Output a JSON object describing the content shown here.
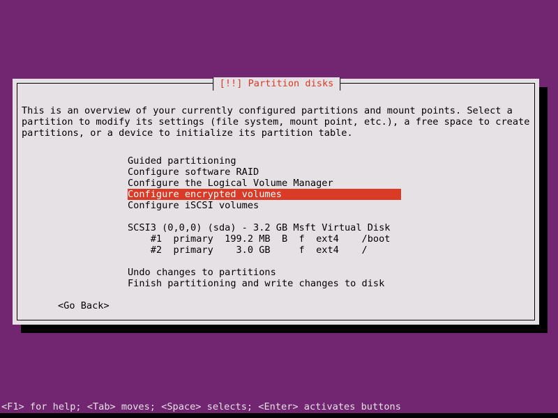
{
  "screen": {
    "background_color": "#722672",
    "foreground_color": "#e6e1e5"
  },
  "dialog": {
    "title": "[!!] Partition disks",
    "title_color": "#d93b26",
    "background_color": "#e6e1e5",
    "border_color": "#000000",
    "description": {
      "line1": "This is an overview of your currently configured partitions and mount points. Select a",
      "line2": "partition to modify its settings (file system, mount point, etc.), a free space to create",
      "line3": "partitions, or a device to initialize its partition table."
    },
    "menu": {
      "highlight_color": "#d93b26",
      "highlight_text_color": "#ffffff",
      "selected_index": 3,
      "items": [
        {
          "label": "Guided partitioning",
          "selected": false
        },
        {
          "label": "Configure software RAID",
          "selected": false
        },
        {
          "label": "Configure the Logical Volume Manager",
          "selected": false
        },
        {
          "label": "Configure encrypted volumes",
          "selected": true
        },
        {
          "label": "Configure iSCSI volumes",
          "selected": false
        }
      ]
    },
    "disk": {
      "header": "SCSI3 (0,0,0) (sda) - 3.2 GB Msft Virtual Disk",
      "partitions": [
        {
          "raw": "    #1  primary  199.2 MB  B  f  ext4    /boot",
          "number": "#1",
          "type": "primary",
          "size": "199.2 MB",
          "flags": "B",
          "format": "f",
          "filesystem": "ext4",
          "mount_point": "/boot"
        },
        {
          "raw": "    #2  primary    3.0 GB     f  ext4    /",
          "number": "#2",
          "type": "primary",
          "size": "3.0 GB",
          "flags": "",
          "format": "f",
          "filesystem": "ext4",
          "mount_point": "/"
        }
      ]
    },
    "actions": {
      "undo": "Undo changes to partitions",
      "finish": "Finish partitioning and write changes to disk"
    },
    "buttons": {
      "go_back": "<Go Back>"
    }
  },
  "help_bar": {
    "text": "<F1> for help; <Tab> moves; <Space> selects; <Enter> activates buttons"
  }
}
